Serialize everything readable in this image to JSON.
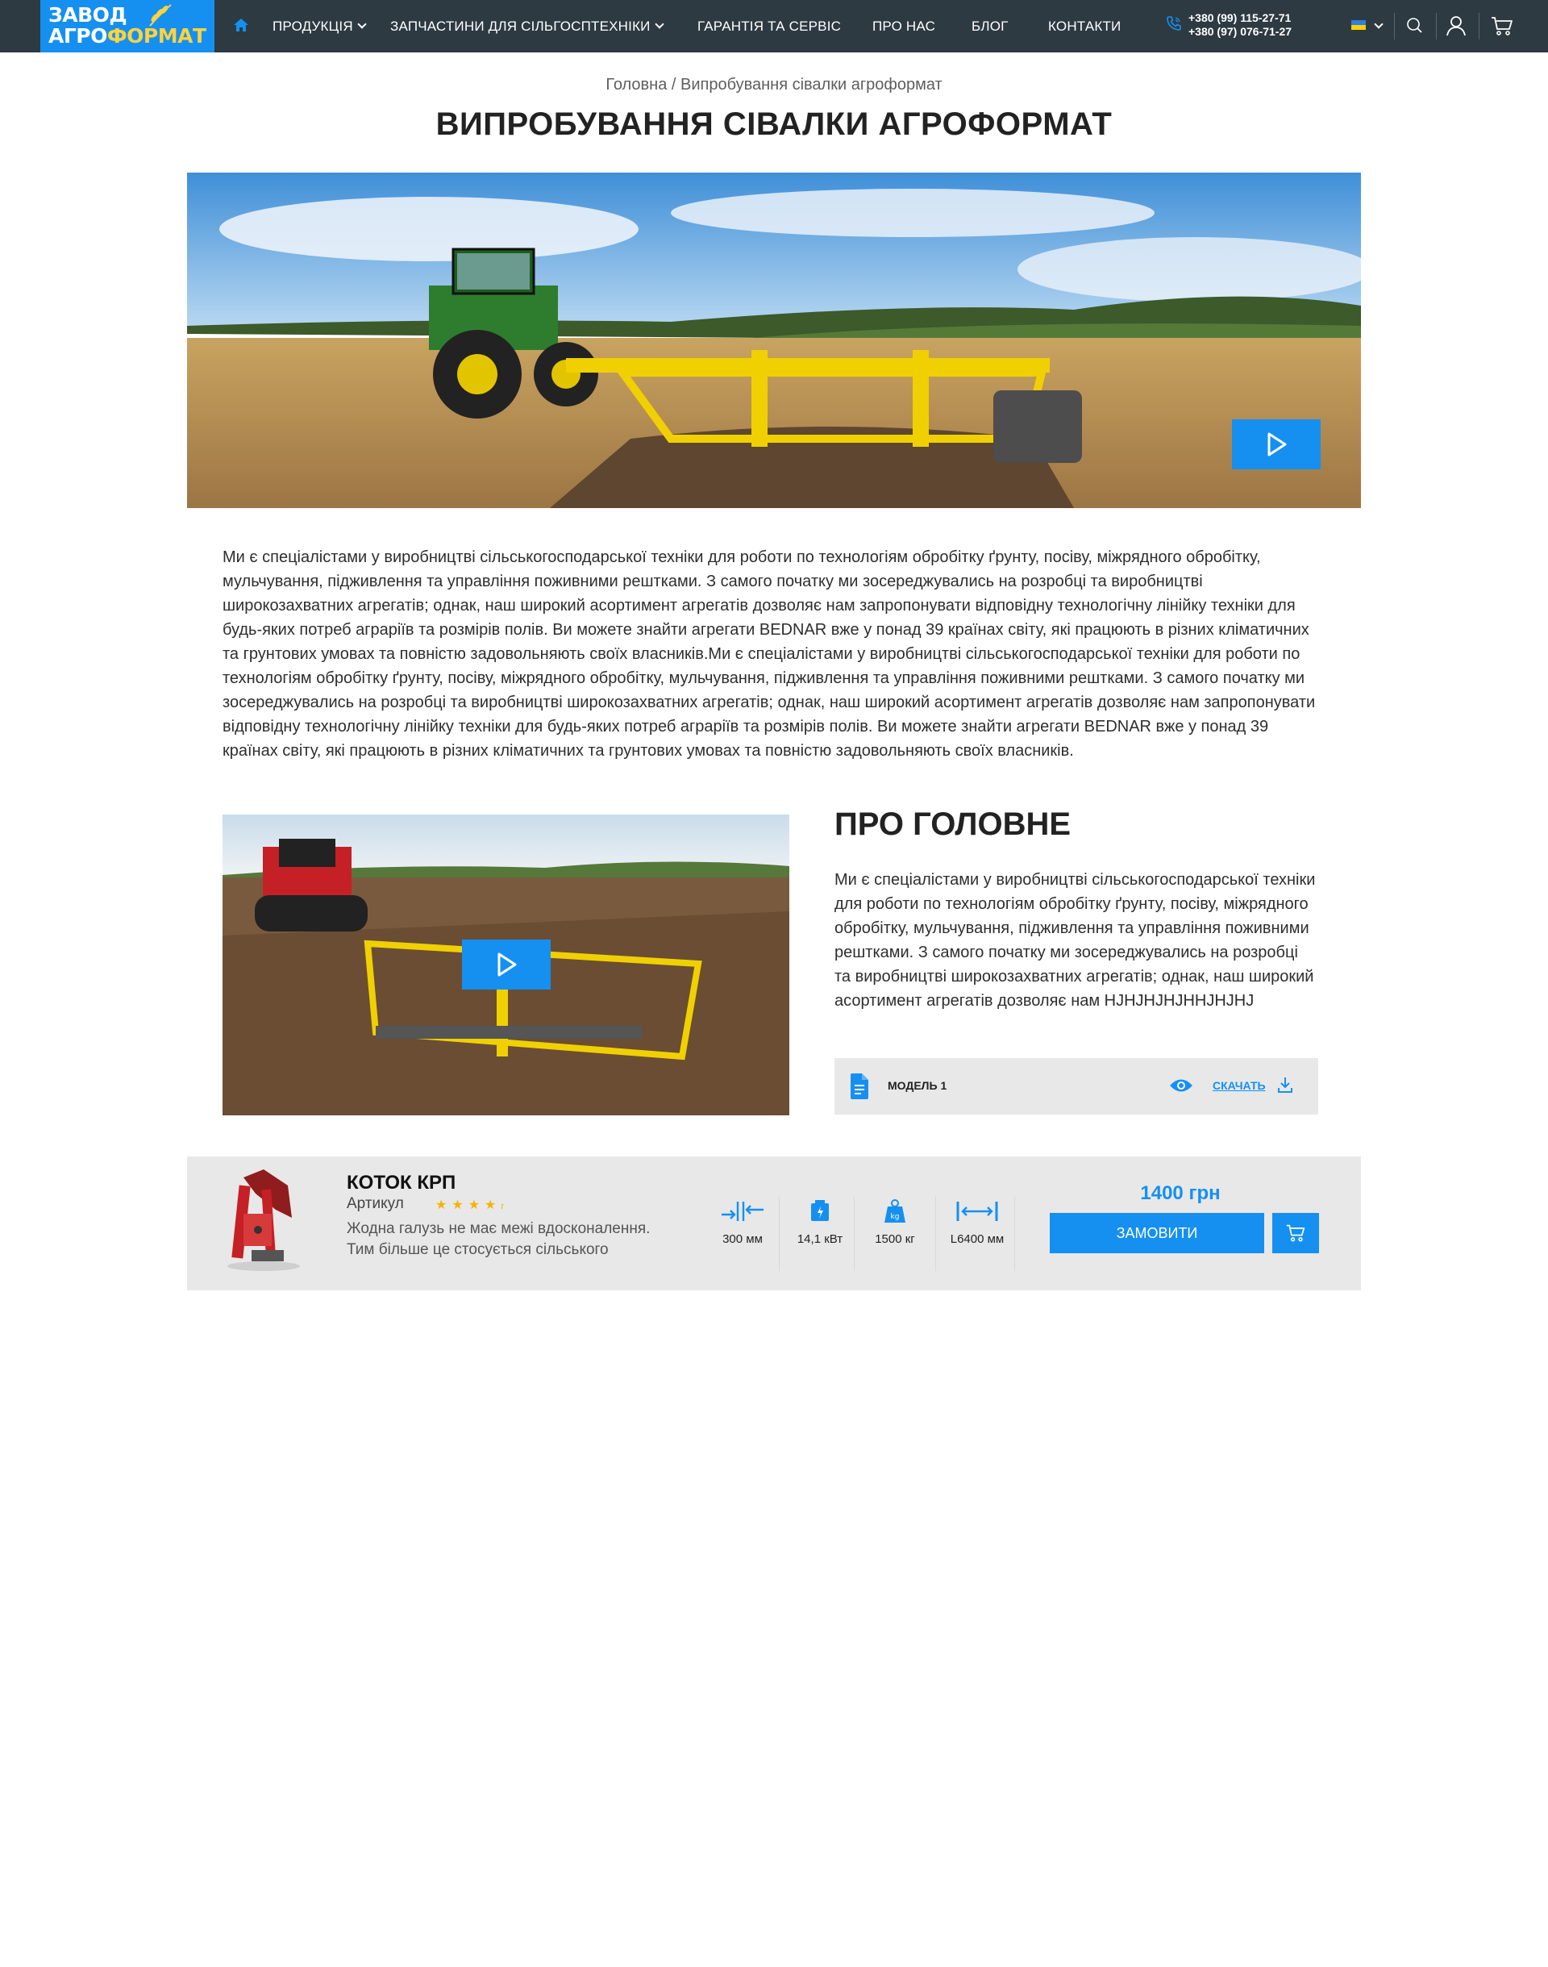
{
  "header": {
    "logo_line1": "ЗАВОД",
    "logo_line2_a": "АГРО",
    "logo_line2_b": "ФОРМАТ",
    "nav": [
      {
        "label": "Продукція",
        "dropdown": true
      },
      {
        "label": "Запчастини для сільгосптехніки",
        "dropdown": true
      },
      {
        "label": "Гарантія та сервіс"
      },
      {
        "label": "Про нас"
      },
      {
        "label": "Блог"
      },
      {
        "label": "Контакти"
      }
    ],
    "phones": [
      "+380 (99) 115-27-71",
      "+380 (97) 076-71-27"
    ],
    "icons": [
      "home-icon",
      "phone-icon",
      "ukraine-flag-icon",
      "search-icon",
      "user-icon",
      "cart-icon"
    ]
  },
  "breadcrumb": "Головна / Випробування сівалки агроформат",
  "title": "ВИПРОБУВАННЯ СІВАЛКИ АГРОФОРМАТ",
  "intro_text": "Ми є спеціалістами у виробництві сільськогосподарської техніки для роботи по технологіям обробітку ґрунту, посіву, міжрядного обробітку, мульчування, підживлення та управління поживними рештками. З самого початку ми зосереджувались на розробці та виробництві широкозахватних агрегатів; однак, наш широкий асортимент агрегатів дозволяє нам запропонувати відповідну технологічну лінійку техніки для будь-яких потреб аграріїв та розмірів полів. Ви можете знайти агрегати BEDNAR вже у понад 39 країнах світу, які працюють в різних кліматичних та грунтових умовах та повністю задовольняють своїх власників.Ми є спеціалістами у виробництві сільськогосподарської техніки для роботи по технологіям обробітку ґрунту, посіву, міжрядного обробітку, мульчування, підживлення та управління поживними рештками. З самого початку ми зосереджувались на розробці та виробництві широкозахватних агрегатів; однак, наш широкий асортимент агрегатів дозволяє нам запропонувати відповідну технологічну лінійку техніки для будь-яких потреб аграріїв та розмірів полів. Ви можете знайти агрегати BEDNAR вже у понад 39 країнах світу, які працюють в різних кліматичних та грунтових умовах та повністю задовольняють своїх власників.",
  "about": {
    "title": "ПРО ГОЛОВНЕ",
    "text": "Ми є спеціалістами у виробництві сільськогосподарської техніки для роботи по технологіям обробітку ґрунту, посіву, міжрядного обробітку, мульчування, підживлення та управління поживними рештками. З самого початку ми зосереджувались на розробці та виробництві широкозахватних агрегатів; однак, наш широкий асортимент агрегатів дозволяє нам HJHJHJHJHHJHJHJ",
    "doc_name": "МОДЕЛЬ 1",
    "download_label": "скачать"
  },
  "product": {
    "name": "КОТОК КРП",
    "article_label": "Артикул",
    "rating": 4,
    "description": "Жодна галузь не має межі вдосконалення. Тим більше це стосується сільського",
    "specs": [
      {
        "icon": "width-icon",
        "value": "300 мм"
      },
      {
        "icon": "power-icon",
        "value": "14,1 кВт"
      },
      {
        "icon": "weight-icon",
        "value": "1500 кг"
      },
      {
        "icon": "length-icon",
        "value": "L6400 мм"
      }
    ],
    "price": "1400 грн",
    "order_label": "Замовити"
  },
  "colors": {
    "accent": "#1590f0",
    "header_bg": "#2e3a41",
    "logo_accent": "#ffd23f",
    "panel_bg": "#e8e8e8"
  }
}
